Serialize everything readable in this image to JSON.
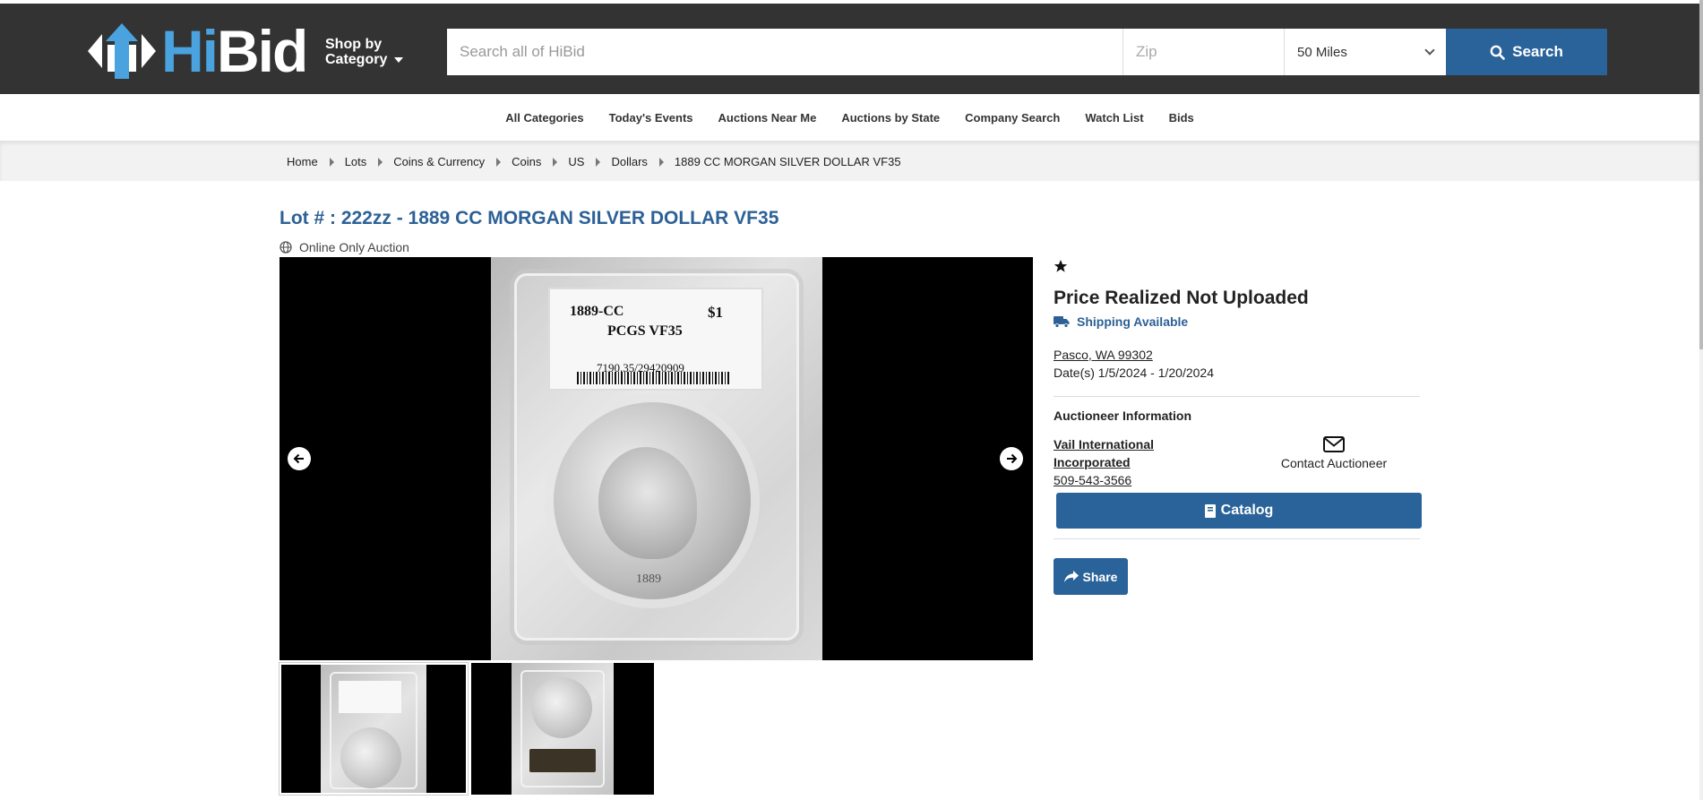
{
  "header": {
    "logo_text": "HiBid",
    "shop_by_category_line1": "Shop by",
    "shop_by_category_line2": "Category",
    "search_placeholder": "Search all of HiBid",
    "zip_placeholder": "Zip",
    "distance_selected": "50 Miles",
    "search_button": "Search"
  },
  "nav": {
    "items": [
      "All Categories",
      "Today's Events",
      "Auctions Near Me",
      "Auctions by State",
      "Company Search",
      "Watch List",
      "Bids"
    ]
  },
  "breadcrumb": {
    "items": [
      "Home",
      "Lots",
      "Coins & Currency",
      "Coins",
      "US",
      "Dollars",
      "1889 CC MORGAN SILVER DOLLAR VF35"
    ]
  },
  "lot": {
    "title": "Lot # : 222zz - 1889 CC MORGAN SILVER DOLLAR VF35",
    "auction_type": "Online Only Auction",
    "photo_label": {
      "year": "1889-CC",
      "denomination": "$1",
      "grade": "PCGS VF35",
      "cert": "7190.35/29420909",
      "coin_date": "1889"
    }
  },
  "panel": {
    "price_status": "Price Realized Not Uploaded",
    "shipping": "Shipping Available",
    "location": "Pasco, WA 99302",
    "dates": "Date(s) 1/5/2024 - 1/20/2024",
    "auctioneer_heading": "Auctioneer Information",
    "auctioneer_name": "Vail International Incorporated",
    "auctioneer_phone": "509-543-3566",
    "contact_label": "Contact Auctioneer",
    "catalog_button": "Catalog",
    "share_button": "Share"
  },
  "colors": {
    "header_bg": "#333333",
    "accent_blue": "#2a6399",
    "title_blue": "#2d6196",
    "logo_blue": "#4aa3df"
  }
}
